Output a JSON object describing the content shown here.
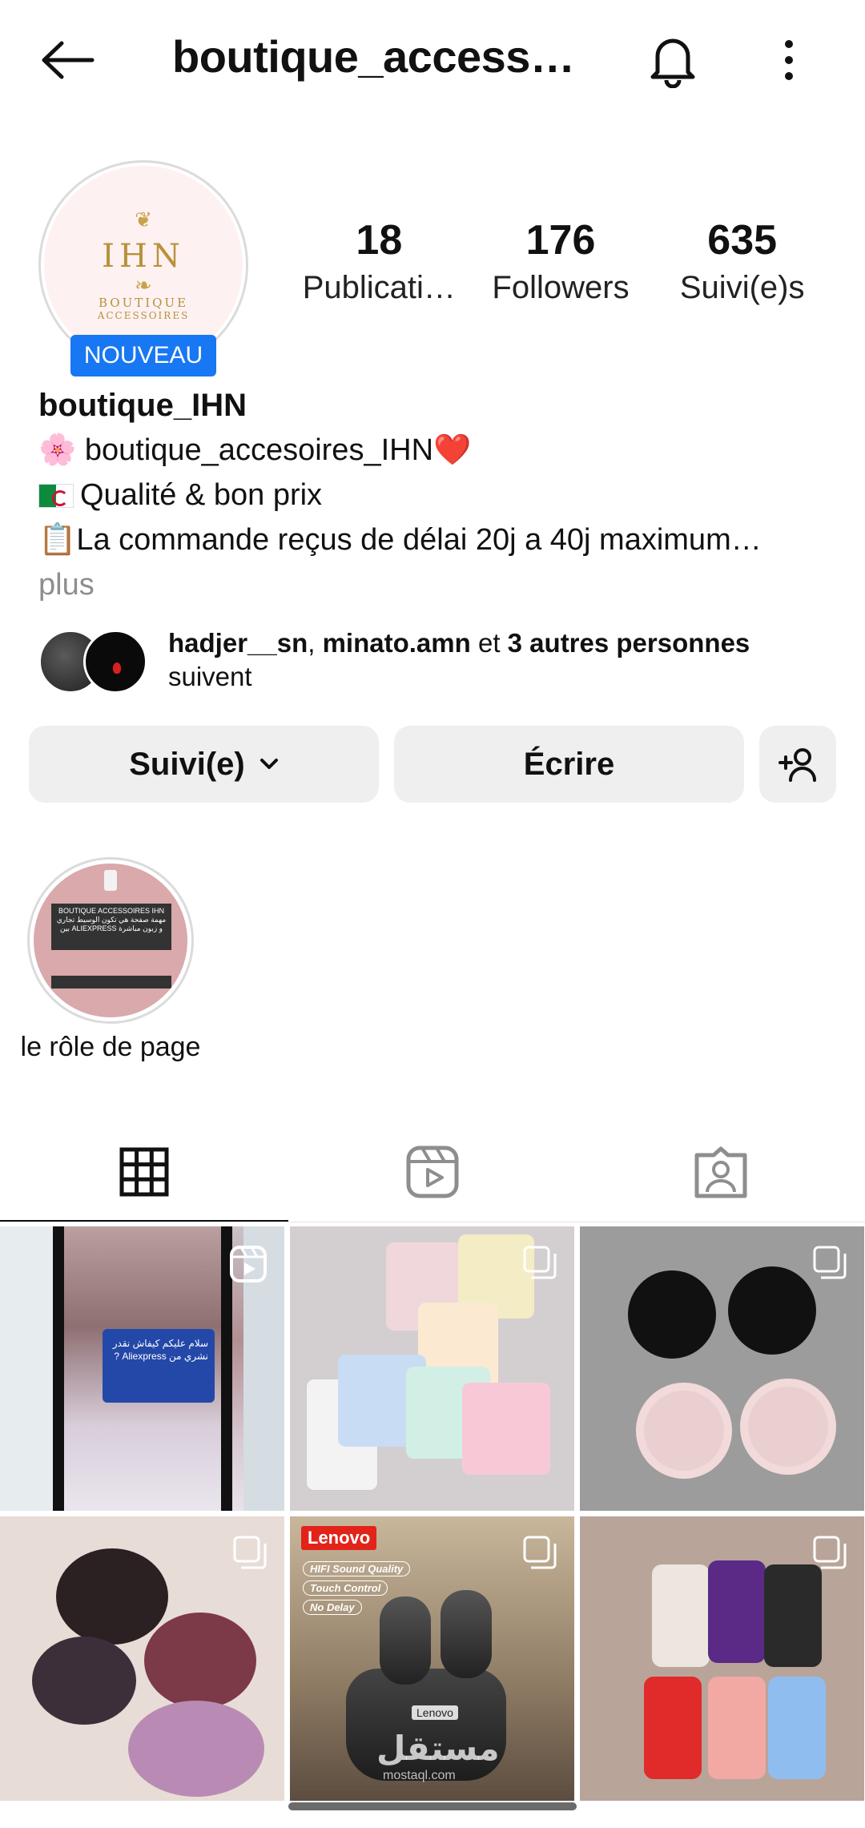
{
  "header": {
    "title": "boutique_access…"
  },
  "profile": {
    "avatar_text_main": "IHN",
    "avatar_text_sub": "BOUTIQUE",
    "avatar_text_sub2": "ACCESSOIRES",
    "new_badge": "NOUVEAU",
    "stats": [
      {
        "value": "18",
        "label": "Publicati…"
      },
      {
        "value": "176",
        "label": "Followers"
      },
      {
        "value": "635",
        "label": "Suivi(e)s"
      }
    ],
    "display_name": "boutique_IHN",
    "bio_lines": [
      "🌸 boutique_accesoires_IHN❤️",
      "Qualité & bon prix",
      "📋La commande reçus de délai 20j a 40j maximum…"
    ],
    "more_label": "plus"
  },
  "followed_by": {
    "names": "hadjer__sn",
    "sep": ", ",
    "name2": "minato.amn",
    "and": " et ",
    "others": "3 autres personnes",
    "suffix": "suivent"
  },
  "actions": {
    "follow_label": "Suivi(e)",
    "write_label": "Écrire"
  },
  "highlight": {
    "label": "le rôle de page",
    "box_text": "BOUTIQUE ACCESSOIRES IHN مهمة صفحة هي تكون الوسيط تجاري بين ALIEXPRESS و زبون مباشرة"
  },
  "grid": {
    "post1_text": "سلام عليكم كيفاش نقدر نشري من Aliexpress ?",
    "post5_brand": "Lenovo",
    "post5_features": [
      "HIFI Sound Quality",
      "Touch Control",
      "No Delay"
    ],
    "post5_case_label": "Lenovo",
    "watermark": "مستقل",
    "watermark_sub": "mostaql.com"
  },
  "colors": {
    "accent_blue": "#1877f2",
    "button_bg": "#efefef"
  }
}
